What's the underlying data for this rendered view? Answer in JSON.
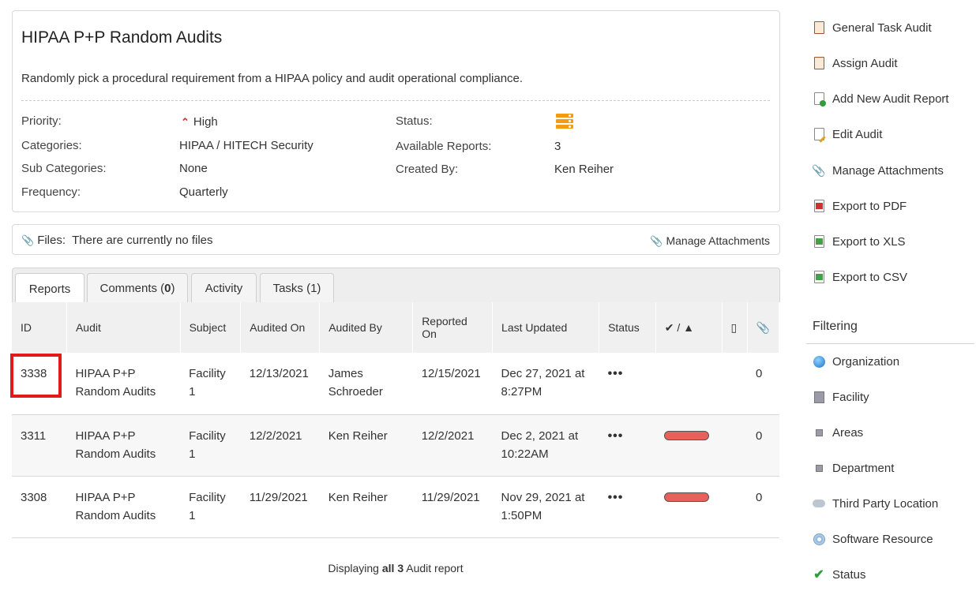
{
  "audit": {
    "title": "HIPAA P+P Random Audits",
    "description": "Randomly pick a procedural requirement from a HIPAA policy and audit operational compliance.",
    "fields": {
      "priority_label": "Priority:",
      "priority_value": "High",
      "categories_label": "Categories:",
      "categories_value": "HIPAA / HITECH Security",
      "subcategories_label": "Sub Categories:",
      "subcategories_value": "None",
      "frequency_label": "Frequency:",
      "frequency_value": "Quarterly",
      "status_label": "Status:",
      "available_reports_label": "Available Reports:",
      "available_reports_value": "3",
      "created_by_label": "Created By:",
      "created_by_value": "Ken Reiher"
    }
  },
  "files": {
    "label": "Files:",
    "message": "There are currently no files",
    "manage": "Manage Attachments"
  },
  "tabs": [
    {
      "label": "Reports"
    },
    {
      "label": "Comments (",
      "count": "0",
      "suffix": ")"
    },
    {
      "label": "Activity"
    },
    {
      "label": "Tasks (1)"
    }
  ],
  "table": {
    "headers": {
      "id": "ID",
      "audit": "Audit",
      "subject": "Subject",
      "audited_on": "Audited On",
      "audited_by": "Audited By",
      "reported_on": "Reported On",
      "last_updated": "Last Updated",
      "status": "Status",
      "check_sep": "/"
    },
    "rows": [
      {
        "id": "3338",
        "audit": "HIPAA P+P Random Audits",
        "subject": "Facility 1",
        "audited_on": "12/13/2021",
        "audited_by": "James Schroeder",
        "reported_on": "12/15/2021",
        "last_updated": "Dec 27, 2021 at 8:27PM",
        "status": "•••",
        "attachments": "0"
      },
      {
        "id": "3311",
        "audit": "HIPAA P+P Random Audits",
        "subject": "Facility 1",
        "audited_on": "12/2/2021",
        "audited_by": "Ken Reiher",
        "reported_on": "12/2/2021",
        "last_updated": "Dec 2, 2021 at 10:22AM",
        "status": "•••",
        "attachments": "0"
      },
      {
        "id": "3308",
        "audit": "HIPAA P+P Random Audits",
        "subject": "Facility 1",
        "audited_on": "11/29/2021",
        "audited_by": "Ken Reiher",
        "reported_on": "11/29/2021",
        "last_updated": "Nov 29, 2021 at 1:50PM",
        "status": "•••",
        "attachments": "0"
      }
    ],
    "footer_prefix": "Displaying",
    "footer_bold": "all 3",
    "footer_suffix": "Audit report"
  },
  "sidebar": {
    "actions": [
      {
        "label": "General Task Audit",
        "icon": "clipboard-icon"
      },
      {
        "label": "Assign Audit",
        "icon": "clipboard-icon"
      },
      {
        "label": "Add New Audit Report",
        "icon": "document-add-icon"
      },
      {
        "label": "Edit Audit",
        "icon": "document-edit-icon"
      },
      {
        "label": "Manage Attachments",
        "icon": "paperclip-icon"
      },
      {
        "label": "Export to PDF",
        "icon": "pdf-icon"
      },
      {
        "label": "Export to XLS",
        "icon": "xls-icon"
      },
      {
        "label": "Export to CSV",
        "icon": "csv-icon"
      }
    ],
    "filtering_heading": "Filtering",
    "filters": [
      {
        "label": "Organization",
        "icon": "globe-icon"
      },
      {
        "label": "Facility",
        "icon": "building-icon"
      },
      {
        "label": "Areas",
        "icon": "area-icon"
      },
      {
        "label": "Department",
        "icon": "department-icon"
      },
      {
        "label": "Third Party Location",
        "icon": "cloud-icon"
      },
      {
        "label": "Software Resource",
        "icon": "disc-icon"
      },
      {
        "label": "Status",
        "icon": "check-icon"
      }
    ]
  },
  "colors": {
    "link": "#0a5fb4",
    "highlight": "#e31a1a",
    "status_bar": "#e8605a",
    "priority": "#c0392b"
  }
}
